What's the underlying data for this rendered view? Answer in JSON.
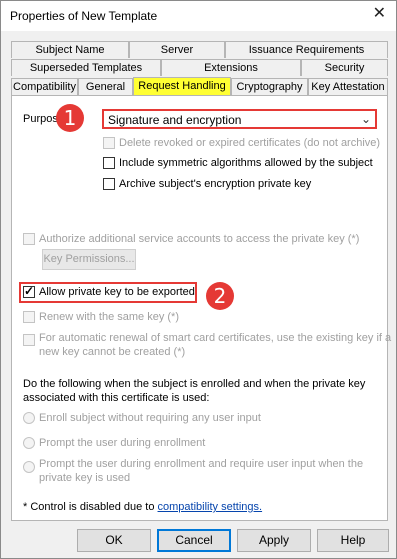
{
  "window": {
    "title": "Properties of New Template",
    "close_glyph": "✕"
  },
  "tabs": {
    "row1": [
      "Subject Name",
      "Server",
      "Issuance Requirements"
    ],
    "row2": [
      "Superseded Templates",
      "Extensions",
      "Security"
    ],
    "row3": [
      "Compatibility",
      "General",
      "Request Handling",
      "Cryptography",
      "Key Attestation"
    ],
    "active": "Request Handling"
  },
  "purpose": {
    "label": "Purpose:",
    "value": "Signature and encryption",
    "arrow": "⌄"
  },
  "options": {
    "delete_revoked": "Delete revoked or expired certificates (do not archive)",
    "include_symmetric": "Include symmetric algorithms allowed by the subject",
    "archive_key": "Archive subject's encryption private key",
    "authorize_accounts": "Authorize additional service accounts to access the private key (*)",
    "key_permissions_button": "Key Permissions...",
    "allow_export": "Allow private key to be exported",
    "renew_same_key": "Renew with the same key (*)",
    "smart_card_line1": "For automatic renewal of smart card certificates, use the existing key if a",
    "smart_card_line2": "new key cannot be created (*)"
  },
  "enroll": {
    "intro_line1": "Do the following when the subject is enrolled and when the private key",
    "intro_line2": "associated with this certificate is used:",
    "radio1": "Enroll subject without requiring any user input",
    "radio2": "Prompt the user during enrollment",
    "radio3_line1": "Prompt the user during enrollment and require user input when the",
    "radio3_line2": "private key is used"
  },
  "footnote": {
    "text": "* Control is disabled due to ",
    "link": "compatibility settings."
  },
  "annotations": {
    "step1": "1",
    "step2": "2",
    "color": "#e53935"
  },
  "buttons": {
    "ok": "OK",
    "cancel": "Cancel",
    "apply": "Apply",
    "help": "Help"
  }
}
